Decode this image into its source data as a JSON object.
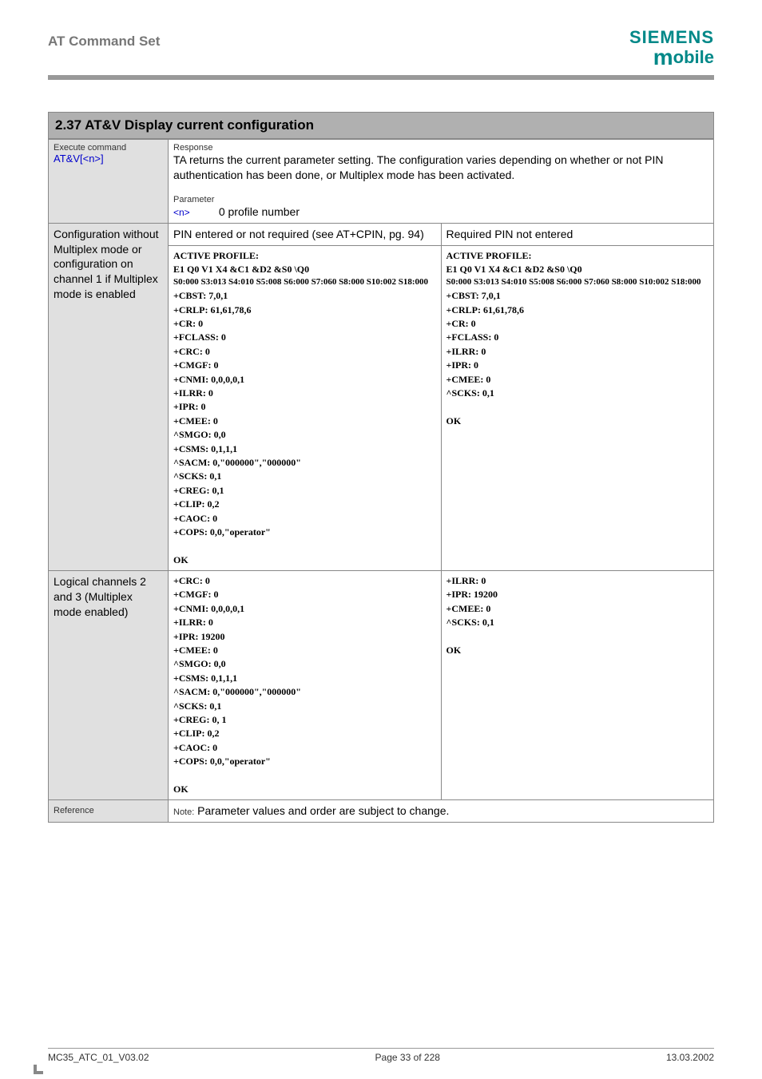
{
  "header": {
    "title": "AT Command Set"
  },
  "logo": {
    "top": "SIEMENS",
    "bottom_m": "m",
    "bottom_rest": "obile"
  },
  "section": {
    "title": "2.37  AT&V  Display current configuration"
  },
  "row1": {
    "left_label": "Execute command",
    "left_cmd": "AT&V[<n>]",
    "resp_label": "Response",
    "resp_text": "TA returns the current parameter setting. The configuration varies depending on whether or not PIN authentication has been done, or Multiplex mode has been activated.",
    "param_label": "Parameter",
    "param_n": "<n>",
    "param_val": "0   profile number"
  },
  "row2": {
    "left_text": "Configuration without Multiplex mode or configuration on channel 1 if Multiplex mode is enabled",
    "left_top": "PIN entered or not required (see AT+CPIN, pg. 94)",
    "right_top": "Required PIN not entered",
    "left_list": [
      "ACTIVE PROFILE:",
      "E1 Q0 V1 X4 &C1 &D2 &S0 \\Q0",
      "S0:000 S3:013 S4:010 S5:008 S6:000 S7:060 S8:000 S10:002 S18:000",
      "+CBST: 7,0,1",
      "+CRLP: 61,61,78,6",
      "+CR: 0",
      "+FCLASS: 0",
      "+CRC: 0",
      "+CMGF: 0",
      "+CNMI: 0,0,0,0,1",
      "+ILRR: 0",
      "+IPR: 0",
      "+CMEE: 0",
      "^SMGO: 0,0",
      "+CSMS: 0,1,1,1",
      "^SACM: 0,\"000000\",\"000000\"",
      "^SCKS: 0,1",
      "+CREG: 0,1",
      "+CLIP: 0,2",
      "+CAOC: 0",
      "+COPS: 0,0,\"operator\"",
      "",
      "OK"
    ],
    "right_list": [
      "ACTIVE PROFILE:",
      "E1 Q0 V1 X4 &C1 &D2 &S0 \\Q0",
      "S0:000 S3:013 S4:010 S5:008 S6:000 S7:060 S8:000 S10:002 S18:000",
      "+CBST: 7,0,1",
      "+CRLP: 61,61,78,6",
      "+CR: 0",
      "+FCLASS: 0",
      "+ILRR: 0",
      "+IPR: 0",
      "+CMEE: 0",
      "^SCKS: 0,1",
      "",
      "OK"
    ]
  },
  "row3": {
    "left_text": "Logical channels 2 and 3 (Multiplex mode enabled)",
    "left_list": [
      "+CRC: 0",
      "+CMGF: 0",
      "+CNMI: 0,0,0,0,1",
      "+ILRR: 0",
      "+IPR: 19200",
      "+CMEE: 0",
      "^SMGO: 0,0",
      "+CSMS: 0,1,1,1",
      "^SACM: 0,\"000000\",\"000000\"",
      "^SCKS: 0,1",
      "+CREG: 0, 1",
      "+CLIP: 0,2",
      "+CAOC: 0",
      "+COPS: 0,0,\"operator\"",
      "",
      "OK"
    ],
    "right_list": [
      "+ILRR: 0",
      "+IPR: 19200",
      "+CMEE: 0",
      "^SCKS: 0,1",
      "",
      "OK"
    ]
  },
  "row4": {
    "left_label": "Reference",
    "note_label": "Note:",
    "note_text": " Parameter values and order are subject to change."
  },
  "footer": {
    "left": "MC35_ATC_01_V03.02",
    "center": "Page 33 of 228",
    "right": "13.03.2002"
  }
}
